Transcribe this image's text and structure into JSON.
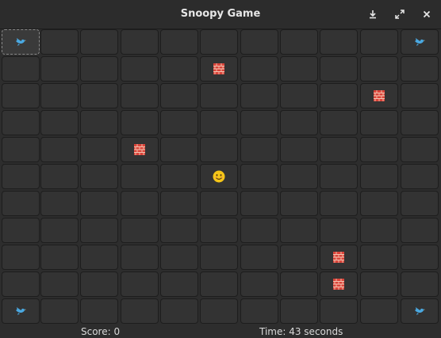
{
  "window": {
    "title": "Snoopy Game"
  },
  "grid": {
    "columns": 11,
    "rows": 11,
    "focused_cell": [
      0,
      0
    ],
    "items": [
      {
        "row": 0,
        "col": 0,
        "type": "bird",
        "icon": "bird-icon"
      },
      {
        "row": 0,
        "col": 10,
        "type": "bird",
        "icon": "bird-icon"
      },
      {
        "row": 1,
        "col": 5,
        "type": "wall",
        "icon": "brick-wall-icon"
      },
      {
        "row": 2,
        "col": 9,
        "type": "wall",
        "icon": "brick-wall-icon"
      },
      {
        "row": 4,
        "col": 3,
        "type": "wall",
        "icon": "brick-wall-icon"
      },
      {
        "row": 5,
        "col": 5,
        "type": "snoopy",
        "icon": "smiley-face-icon"
      },
      {
        "row": 8,
        "col": 8,
        "type": "wall",
        "icon": "brick-wall-icon"
      },
      {
        "row": 9,
        "col": 8,
        "type": "wall",
        "icon": "brick-wall-icon"
      },
      {
        "row": 10,
        "col": 0,
        "type": "bird",
        "icon": "bird-icon"
      },
      {
        "row": 10,
        "col": 10,
        "type": "bird",
        "icon": "bird-icon"
      }
    ]
  },
  "status": {
    "score": "Score: 0",
    "time": "Time: 43 seconds"
  },
  "colors": {
    "bird": "#4aa8e0",
    "wall": "#d9443a",
    "snoopy": "#f5c518"
  }
}
